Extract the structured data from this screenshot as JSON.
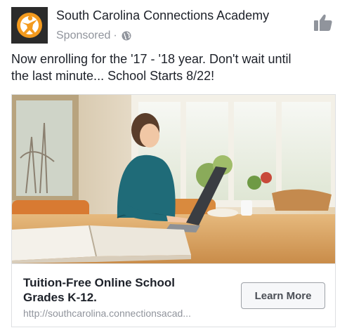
{
  "page": {
    "name": "South Carolina Connections Academy",
    "sponsored_label": "Sponsored",
    "separator": "·",
    "privacy_icon": "globe-icon",
    "like_icon": "thumbs-up-icon"
  },
  "post": {
    "caption_line1": "Now enrolling for the '17 - '18 year.  Don't wait until",
    "caption_line2": "the last minute...  School Starts 8/22!"
  },
  "ad_card": {
    "headline_line1": "Tuition-Free Online School",
    "headline_line2": "Grades K-12.",
    "url": "http://southcarolina.connectionsacad...",
    "cta_label": "Learn More"
  },
  "colors": {
    "text": "#1d2129",
    "meta": "#90949c",
    "border": "#dddfe2",
    "logo_orange": "#f39a1e"
  }
}
